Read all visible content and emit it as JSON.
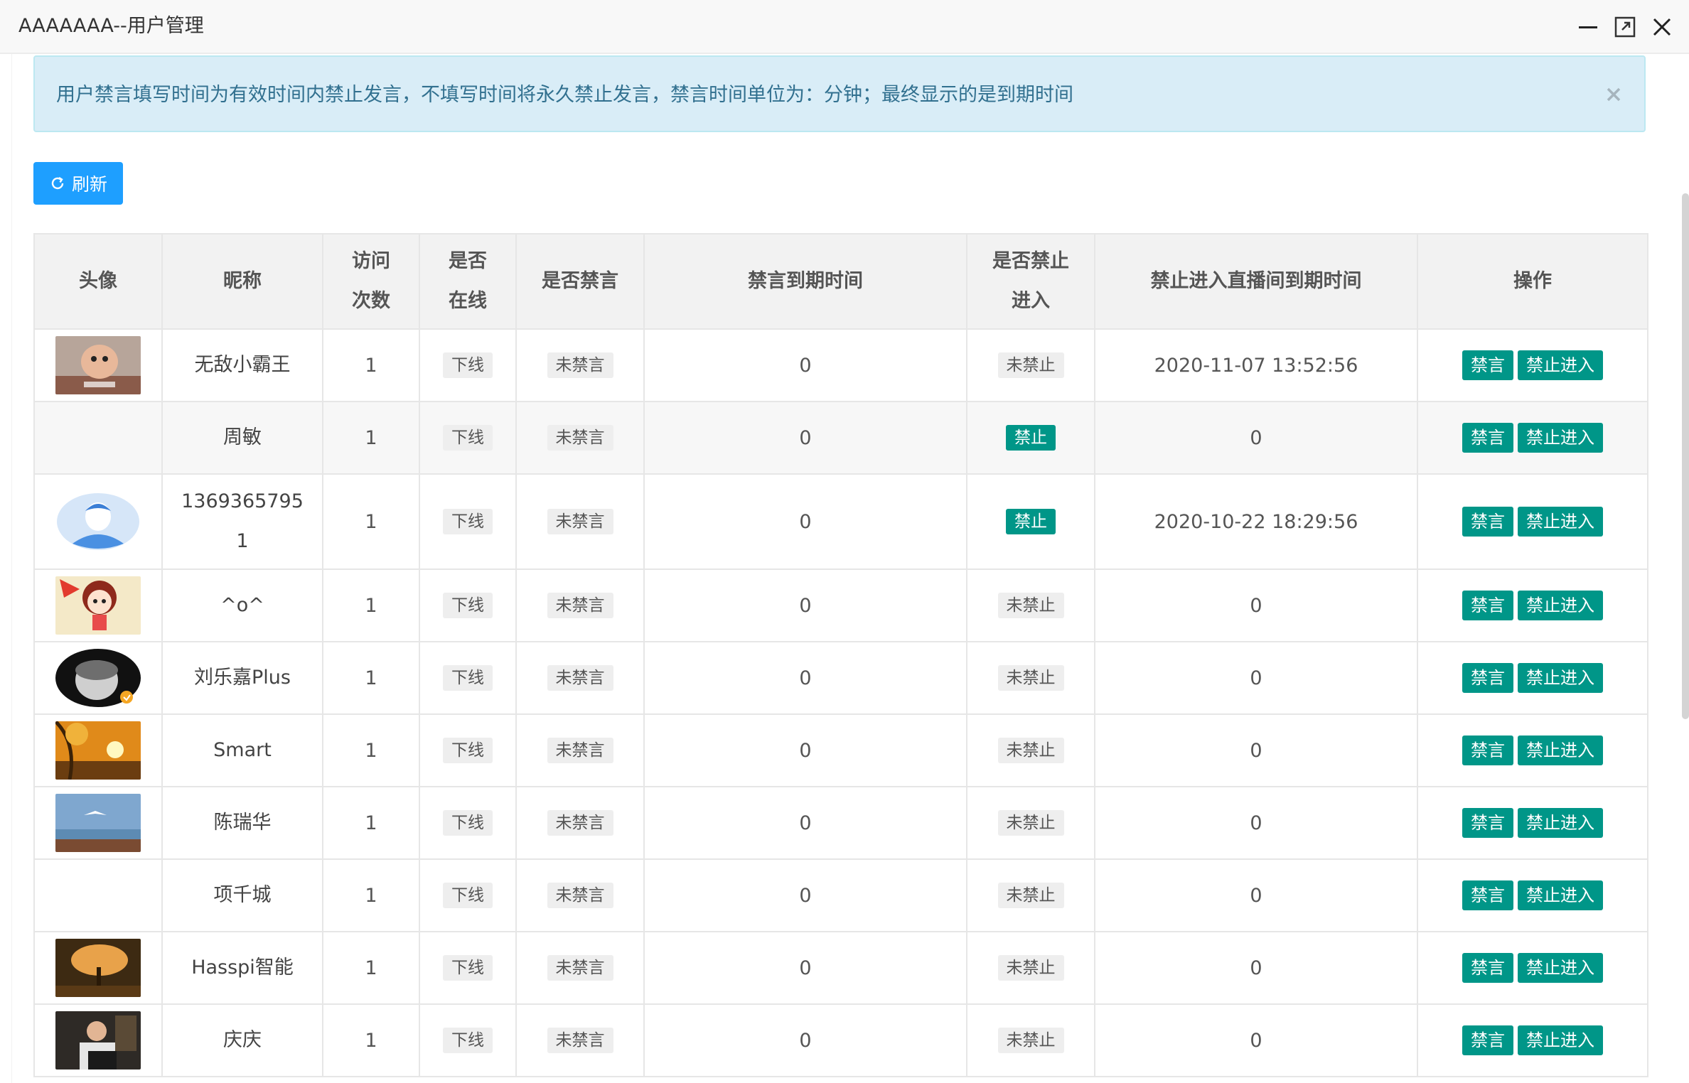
{
  "window": {
    "title": "AAAAAAA--用户管理",
    "minimize_icon": "minimize-icon",
    "maximize_icon": "maximize-icon",
    "close_icon": "close-icon"
  },
  "alert": {
    "text": "用户禁言填写时间为有效时间内禁止发言，不填写时间将永久禁止发言，禁言时间单位为：分钟；最终显示的是到期时间",
    "close_glyph": "×"
  },
  "toolbar": {
    "refresh_label": "刷新",
    "refresh_icon": "refresh-icon"
  },
  "colors": {
    "primary": "#1e9fff",
    "teal": "#009688",
    "alert_bg": "#d9edf7",
    "alert_text": "#31708f"
  },
  "table": {
    "headers": {
      "avatar": "头像",
      "nickname": "昵称",
      "visits_1": "访问",
      "visits_2": "次数",
      "online_1": "是否",
      "online_2": "在线",
      "muted": "是否禁言",
      "mute_expire": "禁言到期时间",
      "banned_1": "是否禁止",
      "banned_2": "进入",
      "ban_expire": "禁止进入直播间到期时间",
      "actions": "操作"
    },
    "actions": {
      "mute": "禁言",
      "ban": "禁止进入"
    },
    "rows": [
      {
        "avatar": "cartoon-boss",
        "nickname": "无敌小霸王",
        "nickname_2": "",
        "visits": "1",
        "online": "下线",
        "muted": "未禁言",
        "mute_expire": "0",
        "banned": "未禁止",
        "ban_expire": "2020-11-07 13:52:56"
      },
      {
        "avatar": "none",
        "nickname": "周敏",
        "nickname_2": "",
        "visits": "1",
        "online": "下线",
        "muted": "未禁言",
        "mute_expire": "0",
        "banned": "禁止",
        "ban_expire": "0"
      },
      {
        "avatar": "default-user",
        "nickname": "1369365795",
        "nickname_2": "1",
        "visits": "1",
        "online": "下线",
        "muted": "未禁言",
        "mute_expire": "0",
        "banned": "禁止",
        "ban_expire": "2020-10-22 18:29:56"
      },
      {
        "avatar": "cartoon-girl",
        "nickname": "^o^",
        "nickname_2": "",
        "visits": "1",
        "online": "下线",
        "muted": "未禁言",
        "mute_expire": "0",
        "banned": "未禁止",
        "ban_expire": "0"
      },
      {
        "avatar": "bw-child",
        "nickname": "刘乐嘉Plus",
        "nickname_2": "",
        "visits": "1",
        "online": "下线",
        "muted": "未禁言",
        "mute_expire": "0",
        "banned": "未禁止",
        "ban_expire": "0"
      },
      {
        "avatar": "autumn-sun",
        "nickname": "Smart",
        "nickname_2": "",
        "visits": "1",
        "online": "下线",
        "muted": "未禁言",
        "mute_expire": "0",
        "banned": "未禁止",
        "ban_expire": "0"
      },
      {
        "avatar": "seagull-sea",
        "nickname": "陈瑞华",
        "nickname_2": "",
        "visits": "1",
        "online": "下线",
        "muted": "未禁言",
        "mute_expire": "0",
        "banned": "未禁止",
        "ban_expire": "0"
      },
      {
        "avatar": "none",
        "nickname": "项千城",
        "nickname_2": "",
        "visits": "1",
        "online": "下线",
        "muted": "未禁言",
        "mute_expire": "0",
        "banned": "未禁止",
        "ban_expire": "0"
      },
      {
        "avatar": "blossom-tree",
        "nickname": "Hasspi智能",
        "nickname_2": "",
        "visits": "1",
        "online": "下线",
        "muted": "未禁言",
        "mute_expire": "0",
        "banned": "未禁止",
        "ban_expire": "0"
      },
      {
        "avatar": "man-laptop",
        "nickname": "庆庆",
        "nickname_2": "",
        "visits": "1",
        "online": "下线",
        "muted": "未禁言",
        "mute_expire": "0",
        "banned": "未禁止",
        "ban_expire": "0"
      }
    ]
  }
}
